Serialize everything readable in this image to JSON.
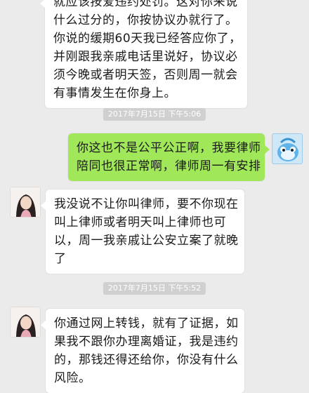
{
  "messages": [
    {
      "side": "left",
      "lines": [
        "就应该按爱违约处罚。这对你来说",
        "什么过分的，你按协议办就行了。",
        "你说的缓期60天我已经答应你了，",
        "并刚跟我亲戚电话里说好，协议必",
        "须今晚或者明天签，否则周一就会",
        "有事情发生在你身上。"
      ]
    },
    {
      "timestamp": "2017年7月15日 下午5:06"
    },
    {
      "side": "right",
      "lines": [
        "你这也不是公平公正啊，我要律师",
        "陪同也很正常啊，律师周一有安排"
      ]
    },
    {
      "side": "left",
      "lines": [
        "我没说不让你叫律师，要不你现在",
        "叫上律师或者明天叫上律师也可",
        "以，周一我亲戚让公安立案了就晚",
        "了"
      ]
    },
    {
      "timestamp": "2017年7月15日 下午5:52"
    },
    {
      "side": "left",
      "lines": [
        "你通过网上转钱，就有了证据，如",
        "果我不跟你办理离婚证，我是违约",
        "的，那钱还得还给你，你没有什么",
        "风险。"
      ]
    }
  ],
  "colors": {
    "background": "#ebebeb",
    "outgoing_bubble": "#a0e759",
    "incoming_bubble": "#ffffff",
    "timestamp_pill": "#d0d0d0"
  }
}
